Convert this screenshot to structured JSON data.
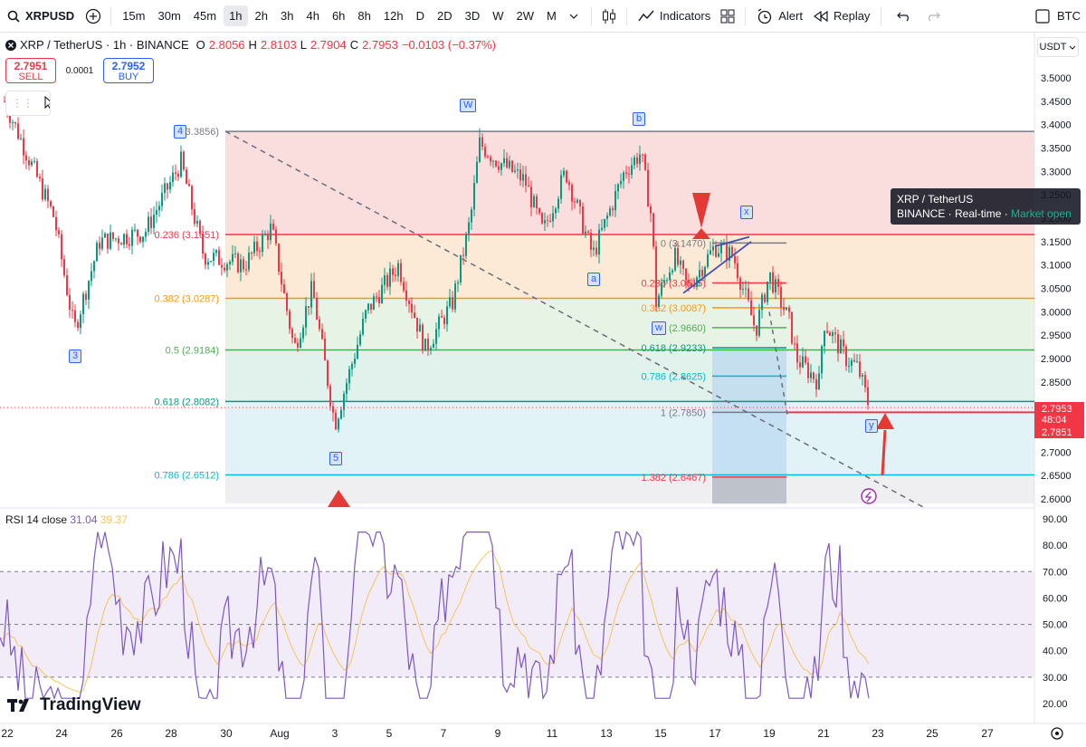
{
  "toolbar": {
    "symbol": "XRPUSD",
    "intervals": [
      "15m",
      "30m",
      "45m",
      "1h",
      "2h",
      "3h",
      "4h",
      "6h",
      "8h",
      "12h",
      "D",
      "2D",
      "3D",
      "W",
      "2W",
      "M"
    ],
    "active_interval": "1h",
    "indicators_label": "Indicators",
    "alert_label": "Alert",
    "replay_label": "Replay",
    "right_symbol": "BTC"
  },
  "legend": {
    "title": "XRP / TetherUS · 1h · BINANCE",
    "o_label": "O",
    "o_value": "2.8056",
    "h_label": "H",
    "h_value": "2.8103",
    "l_label": "L",
    "l_value": "2.7904",
    "c_label": "C",
    "c_value": "2.7953",
    "change": "−0.0103 (−0.37%)"
  },
  "trade": {
    "sell_price": "2.7951",
    "sell_label": "SELL",
    "spread": "0.0001",
    "buy_price": "2.7952",
    "buy_label": "BUY"
  },
  "currency": "USDT",
  "tooltip": {
    "line1": "XRP / TetherUS",
    "line2_a": "BINANCE",
    "line2_b": "Real-time",
    "line2_c": "Market open"
  },
  "price_axis": [
    "3.5000",
    "3.4500",
    "3.4000",
    "3.3500",
    "3.3000",
    "3.2500",
    "3.2000",
    "3.1500",
    "3.1000",
    "3.0500",
    "3.0000",
    "2.9500",
    "2.9000",
    "2.8500",
    "2.8000",
    "2.7500",
    "2.7000",
    "2.6500",
    "2.6000"
  ],
  "price_tags": {
    "current": "2.7953",
    "countdown": "48:04",
    "low": "2.7851"
  },
  "rsi": {
    "label": "RSI 14 close",
    "value1": "31.04",
    "value2": "39.37",
    "axis": [
      "90.00",
      "80.00",
      "70.00",
      "60.00",
      "50.00",
      "40.00",
      "30.00",
      "20.00"
    ]
  },
  "time_axis": [
    "22",
    "24",
    "26",
    "28",
    "30",
    "Aug",
    "3",
    "5",
    "7",
    "9",
    "11",
    "13",
    "15",
    "17",
    "19",
    "21",
    "23",
    "25",
    "27"
  ],
  "fib_left": [
    {
      "label": "0 (3.3856)",
      "color": "#787b86"
    },
    {
      "label": "0.236 (3.1651)",
      "color": "#f23645"
    },
    {
      "label": "0.382 (3.0287)",
      "color": "#ff9800"
    },
    {
      "label": "0.5 (2.9184)",
      "color": "#4caf50"
    },
    {
      "label": "0.618 (2.8082)",
      "color": "#089981"
    },
    {
      "label": "0.786 (2.6512)",
      "color": "#00bcd4"
    }
  ],
  "fib_right": [
    {
      "label": "0 (3.1470)",
      "color": "#787b86"
    },
    {
      "label": "0.236 (3.0615)",
      "color": "#f23645"
    },
    {
      "label": "0.382 (3.0087)",
      "color": "#ff9800"
    },
    {
      "label": "0.5 (2.9660)",
      "color": "#4caf50"
    },
    {
      "label": "0.618 (2.9233)",
      "color": "#089981"
    },
    {
      "label": "0.786 (2.8625)",
      "color": "#00bcd4"
    },
    {
      "label": "1 (2.7850)",
      "color": "#787b86"
    },
    {
      "label": "1.382 (2.6467)",
      "color": "#f23645"
    }
  ],
  "waves": {
    "w3": "3",
    "w4": "4",
    "w5": "5",
    "wW": "W",
    "wa": "a",
    "wb": "b",
    "wx": "x",
    "ww": "w",
    "wy": "y"
  },
  "brand": "TradingView"
}
